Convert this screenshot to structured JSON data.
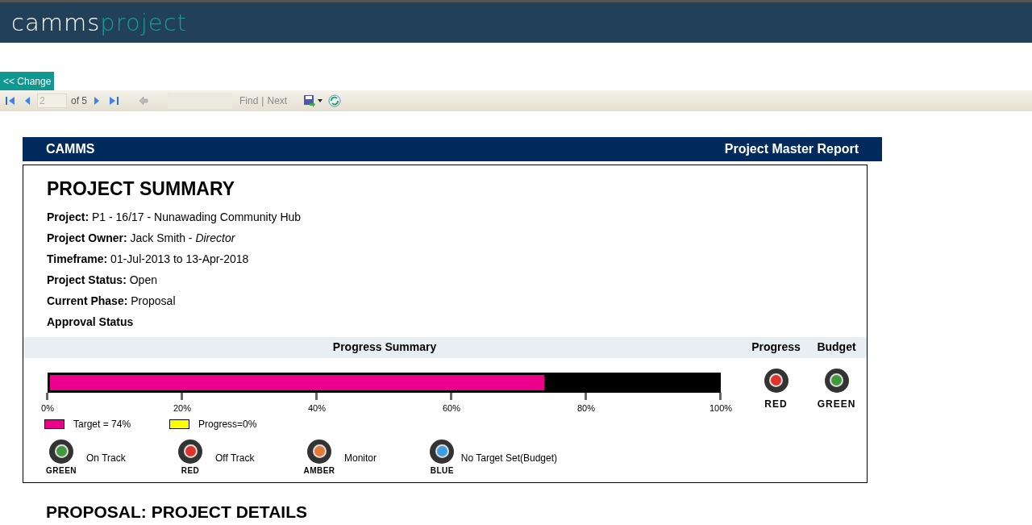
{
  "app_header": {
    "logo_part_1": "camms",
    "logo_part_2": "project"
  },
  "change_button": "<< Change",
  "toolbar": {
    "page_value": "2",
    "page_count": "of 5",
    "find": "Find",
    "separator": "|",
    "next": "Next"
  },
  "report_header": {
    "left": "CAMMS",
    "right": "Project Master Report"
  },
  "summary": {
    "title": "PROJECT SUMMARY",
    "fields": [
      {
        "label": "Project:",
        "value": "P1 - 16/17 - Nunawading Community Hub"
      },
      {
        "label": "Project Owner:",
        "value": "Jack Smith - *Director*"
      },
      {
        "label": "Timeframe:",
        "value": "01-Jul-2013 to 13-Apr-2018"
      },
      {
        "label": "Project Status:",
        "value": "Open"
      },
      {
        "label": "Current Phase:",
        "value": "Proposal"
      },
      {
        "label": "Approval Status"
      }
    ],
    "progress_heading": "Progress Summary",
    "bar": {
      "target": {
        "level": 0.74
      },
      "progress": {
        "level": 0
      },
      "ticks": [
        "0%",
        "20%",
        "40%",
        "60%",
        "80%",
        "100%"
      ]
    },
    "lights": [
      {
        "heading": "Progress",
        "label": "RED",
        "color": "#e0342a"
      },
      {
        "heading": "Budget",
        "label": "GREEN",
        "color": "#3f9a3c"
      }
    ],
    "bar_legend": [
      {
        "label": "Target = 74%",
        "color": "#ec008c"
      },
      {
        "label": "Progress=0%",
        "color": "#ffff00"
      }
    ],
    "light_legend": [
      {
        "label": "GREEN",
        "meaning": "On Track",
        "color": "#3f9a3c"
      },
      {
        "label": "RED",
        "meaning": "Off Track",
        "color": "#e0342a"
      },
      {
        "label": "AMBER",
        "meaning": "Monitor",
        "color": "#e57a35"
      },
      {
        "label": "BLUE",
        "meaning": "No Target Set(Budget)",
        "color": "#3d9ee8"
      }
    ]
  },
  "next_section_title": "PROPOSAL: PROJECT DETAILS"
}
